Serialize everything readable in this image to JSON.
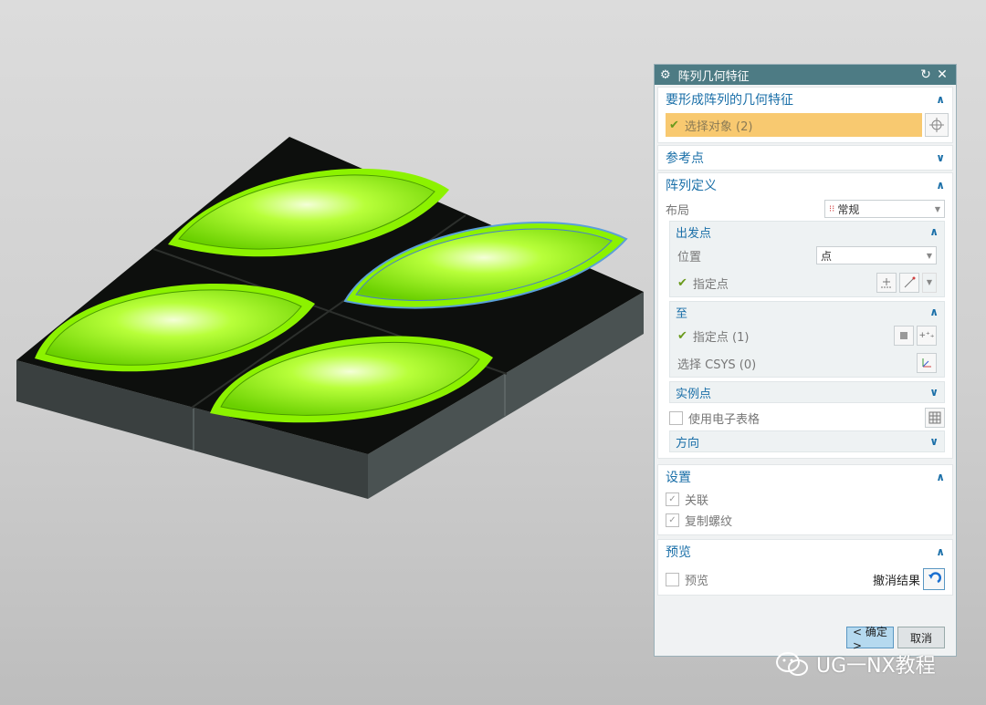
{
  "dialog": {
    "title": "阵列几何特征",
    "group_geometry": {
      "title": "要形成阵列的几何特征",
      "select_object": "选择对象 (2)"
    },
    "group_reference": {
      "title": "参考点"
    },
    "group_array": {
      "title": "阵列定义",
      "layout_label": "布局",
      "layout_value": "常规",
      "from": {
        "title": "出发点",
        "position_label": "位置",
        "position_value": "点",
        "specify_point": "指定点"
      },
      "to": {
        "title": "至",
        "specify_point": "指定点 (1)",
        "select_csys": "选择 CSYS (0)"
      },
      "instance_points": {
        "title": "实例点"
      },
      "use_spreadsheet": "使用电子表格",
      "direction": {
        "title": "方向"
      }
    },
    "group_settings": {
      "title": "设置",
      "associative": "关联",
      "copy_threads": "复制螺纹"
    },
    "group_preview": {
      "title": "预览",
      "preview": "预览",
      "undo_result": "撤消结果"
    },
    "ok_label": "< 确定 >",
    "cancel_label": "取消"
  },
  "watermark": "UG一NX教程",
  "colors": {
    "leaf_green": "#8cf200",
    "plate_black": "#0d0f0d",
    "titlebar": "#4d7b84",
    "selection_bar": "#f8c970",
    "accent_blue": "#1a6fa8"
  }
}
